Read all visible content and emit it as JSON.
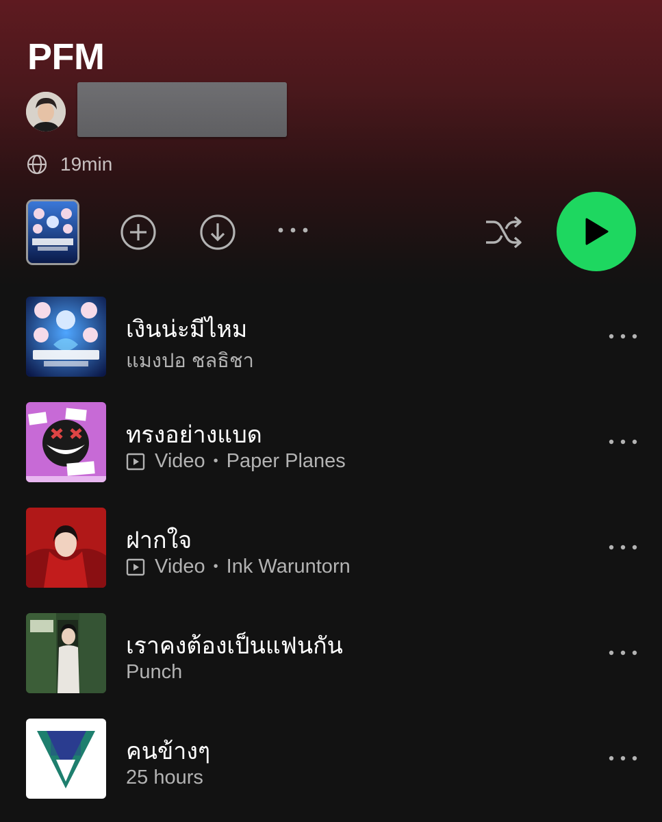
{
  "playlist": {
    "title": "PFM",
    "duration": "19min"
  },
  "colors": {
    "accent": "#1ed760",
    "header_top": "#5e1a20",
    "background": "#121212"
  },
  "icons": {
    "visibility": "globe-icon",
    "add": "add-circle-icon",
    "download": "download-icon",
    "more": "more-icon",
    "shuffle": "shuffle-icon",
    "play": "play-icon",
    "video": "video-icon"
  },
  "tracks": [
    {
      "title": "เงินน่ะมีไหม",
      "artist": "แมงปอ ชลธิชา",
      "is_video": false
    },
    {
      "title": "ทรงอย่างแบด",
      "kind": "Video",
      "artist": "Paper Planes",
      "is_video": true
    },
    {
      "title": "ฝากใจ",
      "kind": "Video",
      "artist": "Ink Waruntorn",
      "is_video": true
    },
    {
      "title": "เราคงต้องเป็นแฟนกัน",
      "artist": "Punch",
      "is_video": false
    },
    {
      "title": "คนข้างๆ",
      "artist": "25 hours",
      "is_video": false
    }
  ]
}
